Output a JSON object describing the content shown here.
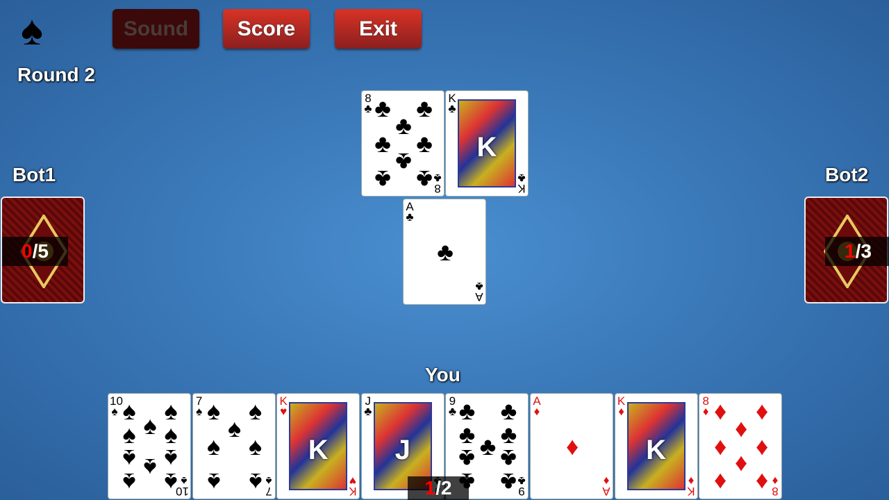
{
  "header": {
    "suit_icon": "spade-icon",
    "round_label": "Round 2",
    "buttons": {
      "sound": "Sound",
      "score": "Score",
      "exit": "Exit"
    }
  },
  "players": {
    "bot1": {
      "name": "Bot1",
      "won": "0",
      "total": "5"
    },
    "bot2": {
      "name": "Bot2",
      "won": "1",
      "total": "3"
    },
    "you": {
      "name": "You",
      "won": "1",
      "total": "2"
    }
  },
  "table_cards": [
    {
      "rank": "8",
      "suit": "♣"
    },
    {
      "rank": "K",
      "suit": "♣"
    },
    {
      "rank": "A",
      "suit": "♣"
    }
  ],
  "hand": [
    {
      "rank": "10",
      "suit": "♠"
    },
    {
      "rank": "7",
      "suit": "♠"
    },
    {
      "rank": "K",
      "suit": "♥"
    },
    {
      "rank": "J",
      "suit": "♣"
    },
    {
      "rank": "9",
      "suit": "♣"
    },
    {
      "rank": "A",
      "suit": "♦"
    },
    {
      "rank": "K",
      "suit": "♦"
    },
    {
      "rank": "8",
      "suit": "♦"
    }
  ],
  "colors": {
    "table": "#3a78b8",
    "button": "#c42a22",
    "count_won": "#ff0000"
  }
}
